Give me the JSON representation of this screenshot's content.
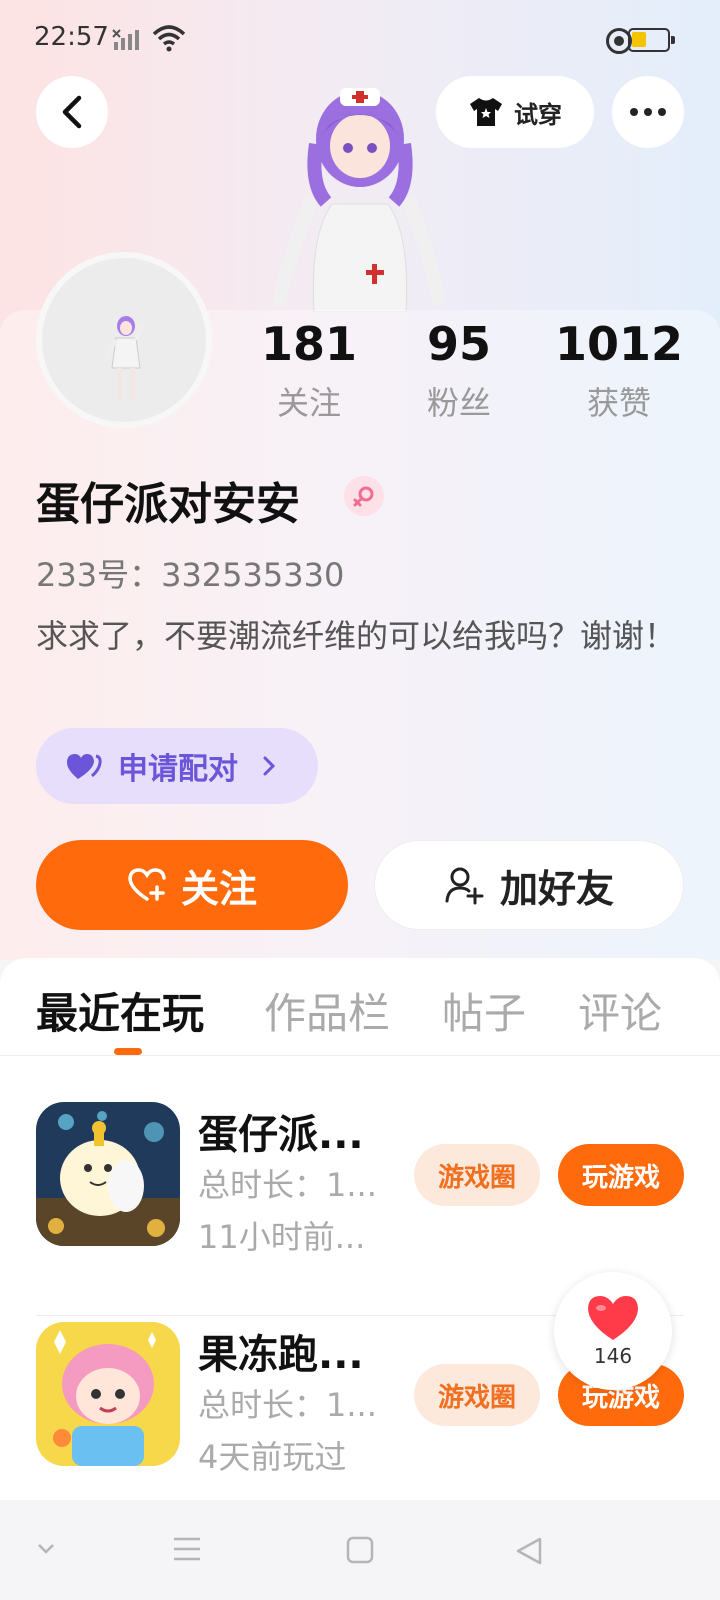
{
  "status_bar": {
    "time": "22:57"
  },
  "header": {
    "try_on_label": "试穿"
  },
  "stats": [
    {
      "value": "181",
      "label": "关注"
    },
    {
      "value": "95",
      "label": "粉丝"
    },
    {
      "value": "1012",
      "label": "获赞"
    }
  ],
  "profile": {
    "nickname": "蛋仔派对安安",
    "user_id": "233号：332535330",
    "bio": "求求了，不要潮流纤维的可以给我吗？谢谢！",
    "pair_label": "申请配对"
  },
  "actions": {
    "follow_label": "关注",
    "add_friend_label": "加好友"
  },
  "tabs": [
    {
      "label": "最近在玩",
      "active": true
    },
    {
      "label": "作品栏",
      "active": false
    },
    {
      "label": "帖子",
      "active": false
    },
    {
      "label": "评论",
      "active": false
    }
  ],
  "games": [
    {
      "title": "蛋仔派...",
      "playtime": "总时长：1...",
      "last_played": "11小时前...",
      "circle_label": "游戏圈",
      "play_label": "玩游戏"
    },
    {
      "title": "果冻跑...",
      "playtime": "总时长：1...",
      "last_played": "4天前玩过",
      "circle_label": "游戏圈",
      "play_label": "玩游戏"
    }
  ],
  "like": {
    "count": "146"
  },
  "colors": {
    "accent": "#ff6b0c",
    "pair_bg": "#e6defa",
    "pair_text": "#6b55d8",
    "like_red": "#ff3b4a"
  },
  "icons": [
    "back-icon",
    "shirt-icon",
    "more-icon",
    "female-icon",
    "heart-pair-icon",
    "chevron-right-icon",
    "heart-plus-icon",
    "add-user-icon",
    "heart-icon",
    "nav-down-icon",
    "nav-menu-icon",
    "nav-home-icon",
    "nav-back-icon"
  ]
}
